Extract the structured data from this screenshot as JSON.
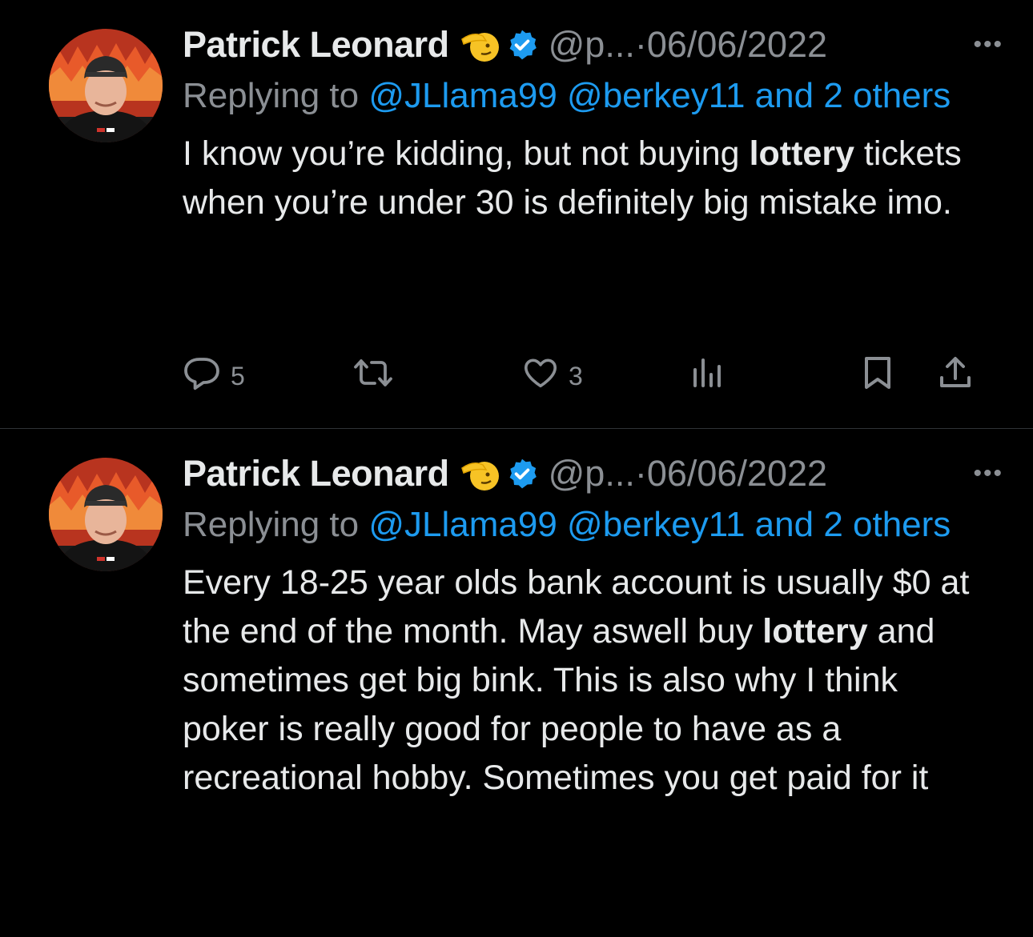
{
  "tweets": [
    {
      "display_name": "Patrick Leonard",
      "handle": "@p...",
      "separator": "·",
      "date": "06/06/2022",
      "more_label": "•••",
      "replying_prefix": "Replying to",
      "replying_mentions": "@JLlama99 @berkey11 and 2 others",
      "body": {
        "part1": "I know you’re kidding, but not buying ",
        "bold1": "lottery",
        "part2": " tickets when you’re under 30 is definitely big mistake imo."
      },
      "actions": {
        "reply_count": "5",
        "retweet_count": "",
        "like_count": "3"
      }
    },
    {
      "display_name": "Patrick Leonard",
      "handle": "@p...",
      "separator": "·",
      "date": "06/06/2022",
      "more_label": "•••",
      "replying_prefix": "Replying to",
      "replying_mentions": "@JLlama99 @berkey11 and 2 others",
      "body": {
        "part1": "Every 18-25 year olds bank account is usually $0 at the end of the month. May aswell buy ",
        "bold1": "lottery",
        "part2": " and sometimes get big bink. This is also why I think poker is really good for people to have as a recreational hobby. Sometimes you get paid for it"
      }
    }
  ],
  "icons": {
    "name_emoji": "saluting-face-emoji-icon",
    "verified": "verified-badge-icon",
    "reply": "reply-bubble-icon",
    "retweet": "retweet-icon",
    "like": "heart-icon",
    "views": "views-bar-chart-icon",
    "bookmark": "bookmark-icon",
    "share": "share-upload-icon"
  },
  "colors": {
    "background": "#000000",
    "text_primary": "#e7e9ea",
    "text_secondary": "#8b8f94",
    "accent_blue": "#1d9bf0",
    "divider": "#2f3336"
  }
}
